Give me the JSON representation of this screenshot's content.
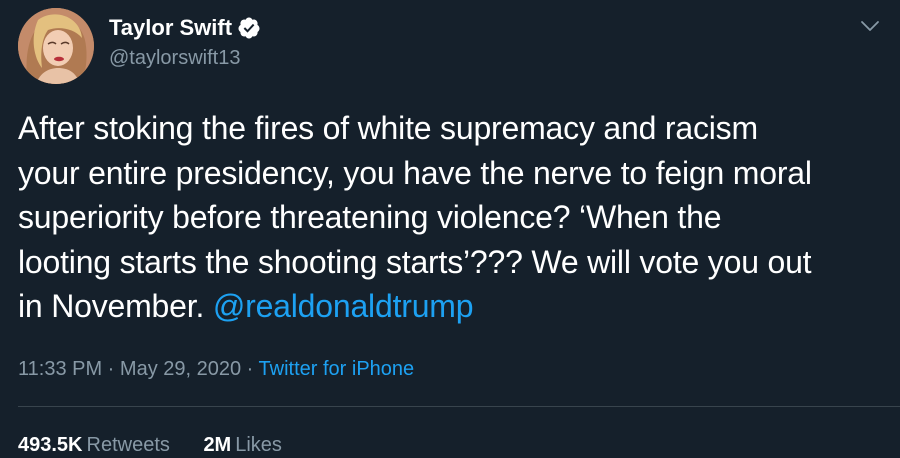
{
  "author": {
    "display_name": "Taylor Swift",
    "handle": "@taylorswift13",
    "verified": true
  },
  "tweet": {
    "lines": [
      "After stoking the fires of white supremacy and racism",
      "your entire presidency, you have the nerve to feign moral",
      "superiority before threatening violence? ‘When the",
      "looting starts the shooting starts’??? We will vote you out"
    ],
    "last_line_text": "in November. ",
    "mention": "@realdonaldtrump"
  },
  "meta": {
    "time": "11:33 PM",
    "date": "May 29, 2020",
    "separator": " · ",
    "source": "Twitter for iPhone"
  },
  "stats": {
    "retweets_value": "493.5K",
    "retweets_label": "Retweets",
    "likes_value": "2M",
    "likes_label": "Likes"
  },
  "colors": {
    "background": "#15202b",
    "text": "#ffffff",
    "secondary": "#8899a6",
    "accent": "#1da1f2"
  },
  "icons": {
    "verified": "verified-badge-icon",
    "menu": "chevron-down-icon"
  }
}
